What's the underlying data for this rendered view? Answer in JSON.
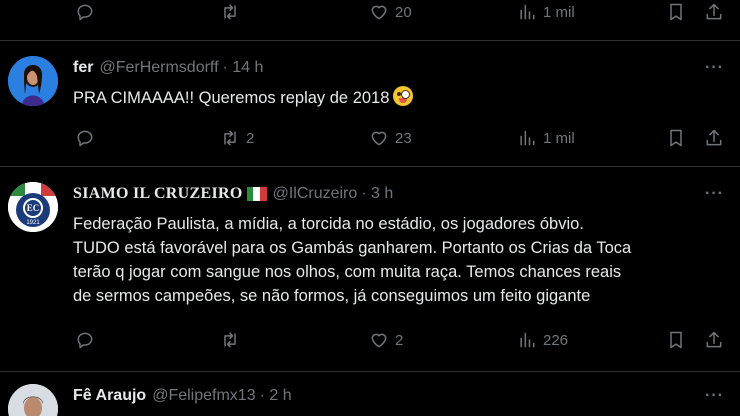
{
  "top_actions": {
    "reply_count": "",
    "retweet_count": "",
    "like_count": "20",
    "view_count": "1 mil"
  },
  "tweets": [
    {
      "name": "fer",
      "handle": "@FerHermsdorff",
      "time": "· 14 h",
      "text": "PRA CIMAAAA!! Queremos replay de 2018",
      "emoji": "zany-face-emoji",
      "more": "···",
      "actions": {
        "reply_count": "",
        "retweet_count": "2",
        "like_count": "23",
        "view_count": "1 mil"
      }
    },
    {
      "name": "SIAMO IL CRUZEIRO",
      "handle": "@IlCruzeiro",
      "time": "· 3 h",
      "text_lines": [
        "Federação Paulista, a mídia, a torcida no estádio, os jogadores óbvio.",
        "TUDO está favorável para os Gambás ganharem. Portanto os Crias da Toca",
        "terão q jogar com sangue nos olhos, com muita raça. Temos chances reais",
        "de sermos campeões, se não formos, já conseguimos um feito gigante"
      ],
      "avatar_text": "1921",
      "more": "···",
      "actions": {
        "reply_count": "",
        "retweet_count": "",
        "like_count": "2",
        "view_count": "226"
      }
    },
    {
      "name": "Fê Araujo",
      "handle": "@Felipefmx13",
      "time": "· 2 h",
      "more": "···"
    }
  ],
  "colors": {
    "background": "#000000",
    "text": "#e7e9ea",
    "muted": "#71767b",
    "divider": "#2f3336"
  }
}
